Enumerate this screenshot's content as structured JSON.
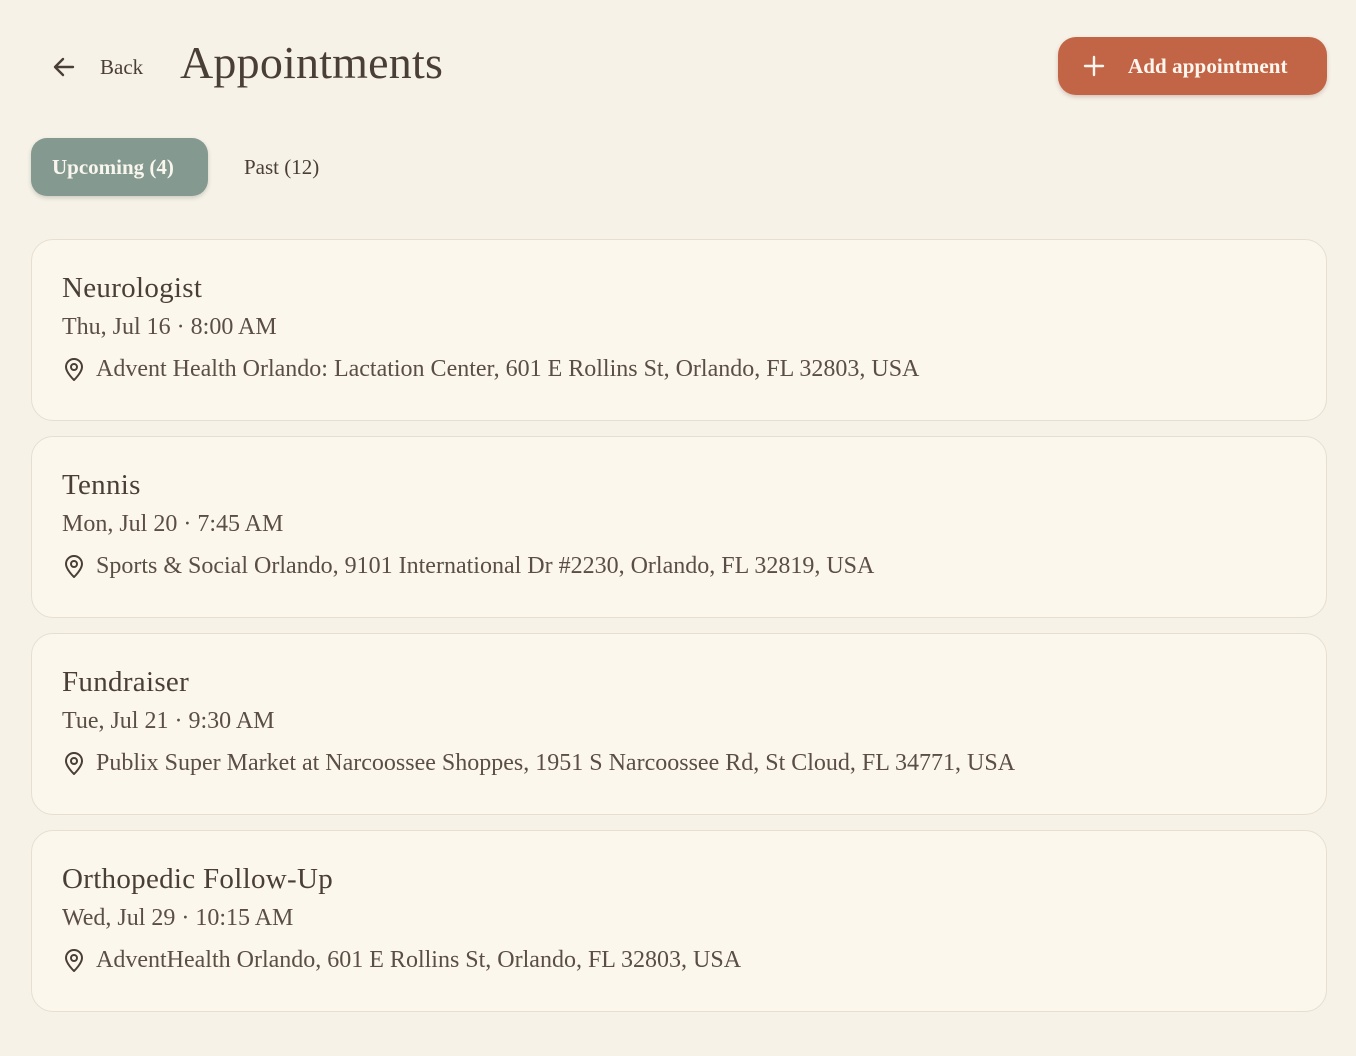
{
  "header": {
    "back_label": "Back",
    "title": "Appointments",
    "add_label": "Add appointment"
  },
  "tabs": [
    {
      "label": "Upcoming (4)",
      "active": true
    },
    {
      "label": "Past (12)",
      "active": false
    }
  ],
  "appointments": [
    {
      "title": "Neurologist",
      "when": "Thu, Jul 16 · 8:00 AM",
      "location": "Advent Health Orlando: Lactation Center, 601 E Rollins St, Orlando, FL 32803, USA"
    },
    {
      "title": "Tennis",
      "when": "Mon, Jul 20 · 7:45 AM",
      "location": "Sports & Social Orlando, 9101 International Dr #2230, Orlando, FL 32819, USA"
    },
    {
      "title": "Fundraiser",
      "when": "Tue, Jul 21 · 9:30 AM",
      "location": "Publix Super Market at Narcoossee Shoppes, 1951 S Narcoossee Rd, St Cloud, FL 34771, USA"
    },
    {
      "title": "Orthopedic Follow-Up",
      "when": "Wed, Jul 29 · 10:15 AM",
      "location": "AdventHealth Orlando, 601 E Rollins St, Orlando, FL 32803, USA"
    }
  ],
  "icons": {
    "back": "arrow-left-icon",
    "add": "plus-icon",
    "location": "map-pin-icon"
  },
  "colors": {
    "background": "#f6f2e8",
    "accent": "#c26547",
    "tab_active": "#84998f",
    "card": "#fbf7ed",
    "text": "#4a3f37"
  }
}
